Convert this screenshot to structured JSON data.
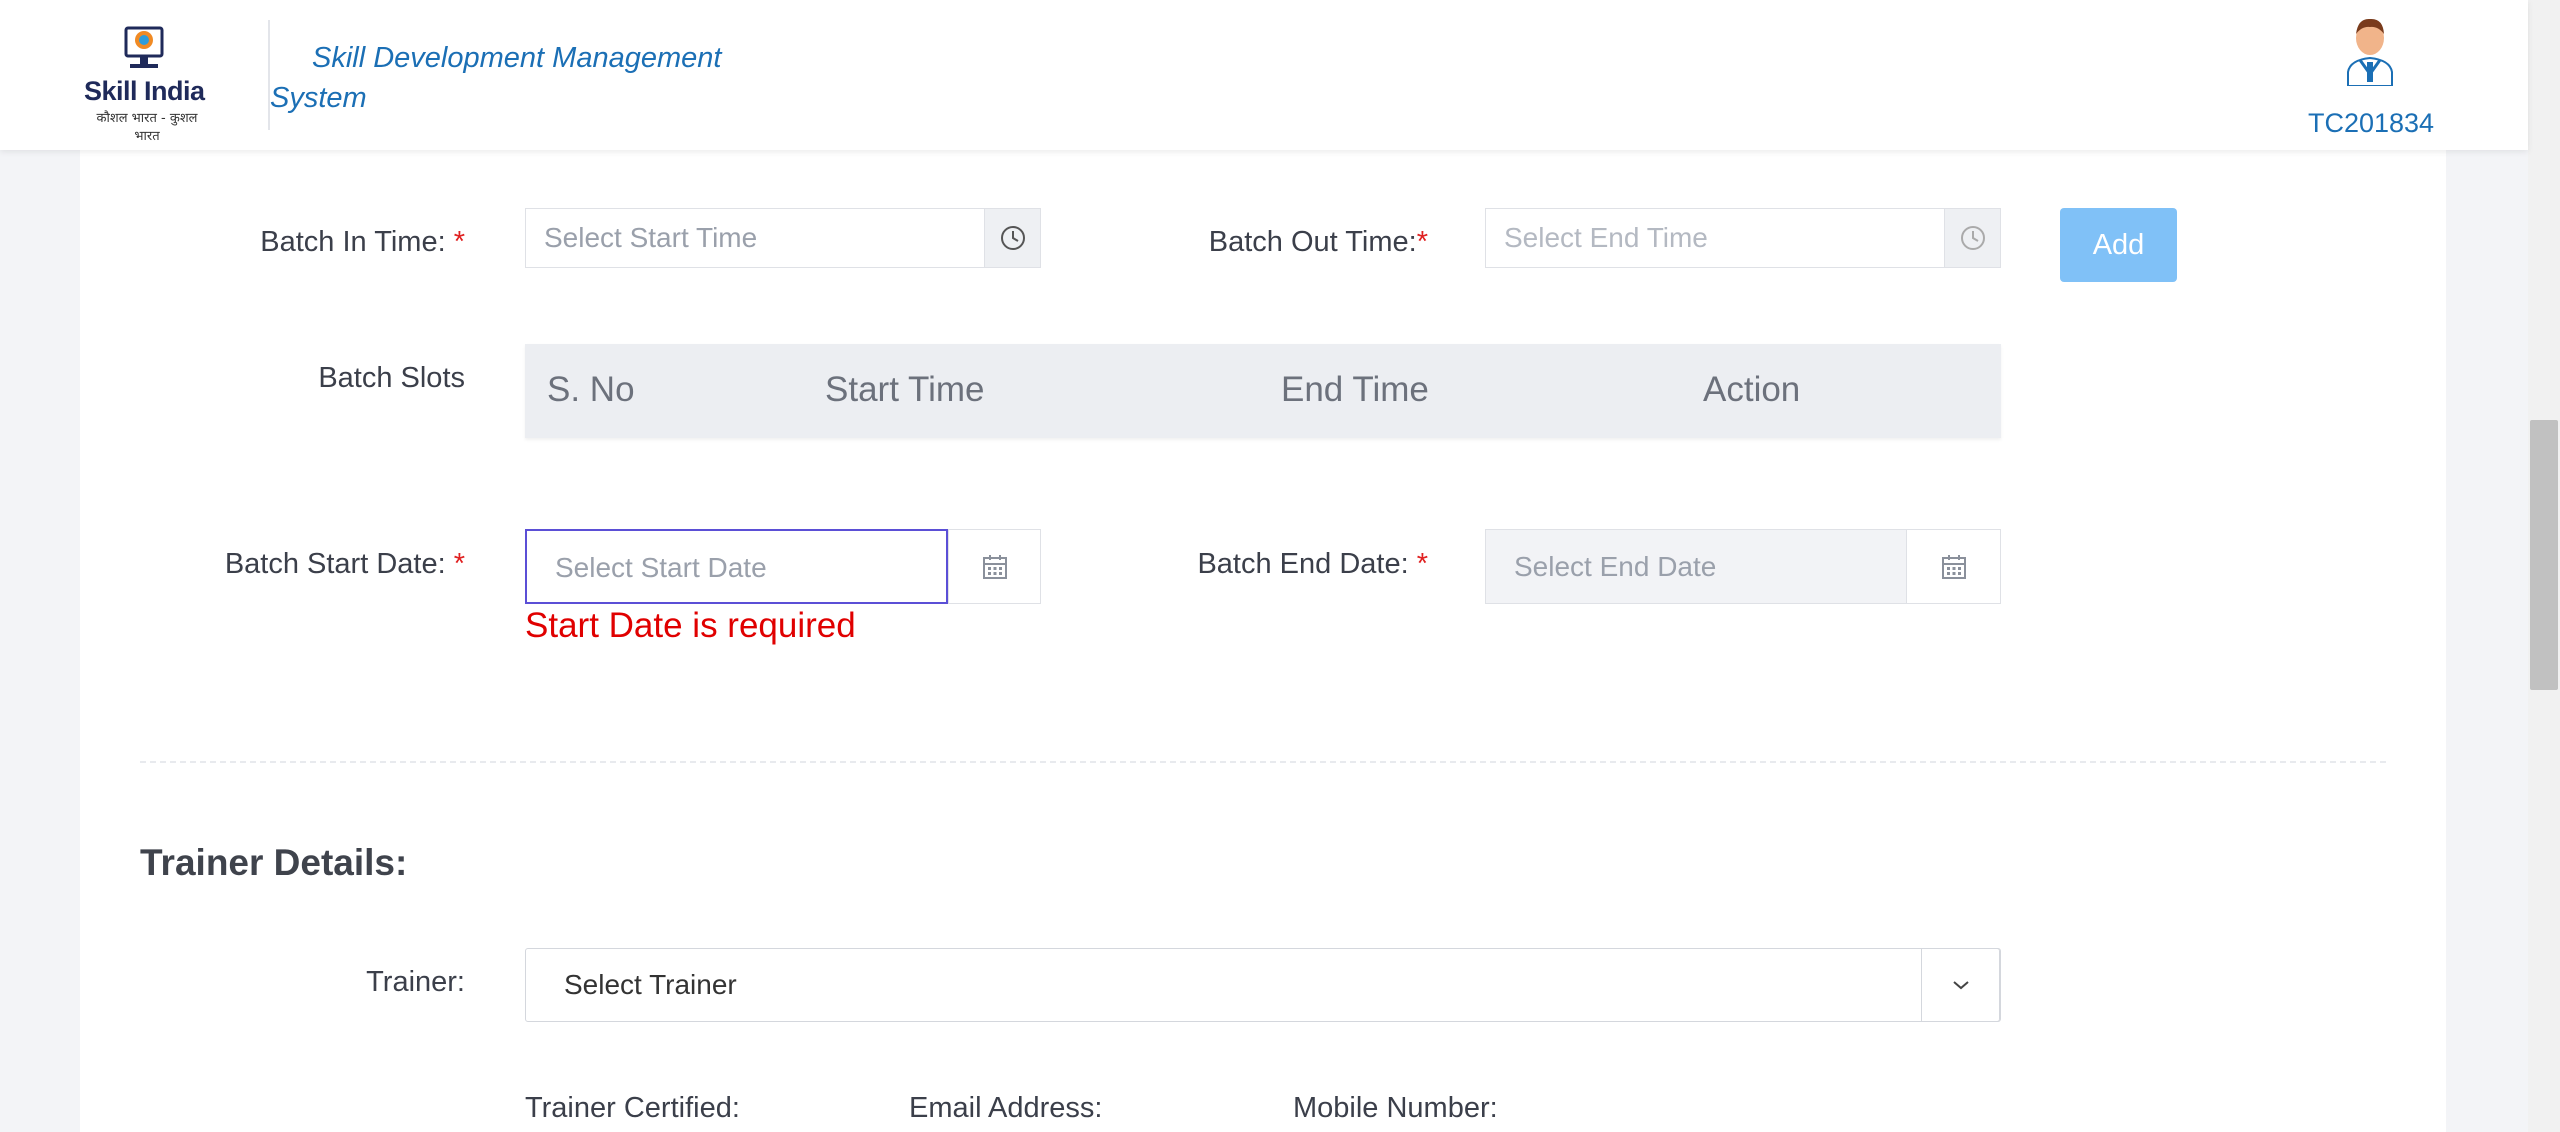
{
  "header": {
    "logo_text": "Skill India",
    "logo_tagline": "कौशल भारत - कुशल भारत",
    "system_title_line1": "Skill Development Management",
    "system_title_line2": "System",
    "user_id": "TC201834"
  },
  "form": {
    "batch_in_time": {
      "label": "Batch In Time: ",
      "required": "*",
      "placeholder": "Select Start Time"
    },
    "batch_out_time": {
      "label": "Batch Out Time:",
      "required": "*",
      "placeholder": "Select End Time"
    },
    "add_button": "Add",
    "batch_slots": {
      "label": "Batch Slots",
      "columns": [
        "S. No",
        "Start Time",
        "End Time",
        "Action"
      ]
    },
    "batch_start_date": {
      "label": "Batch Start Date: ",
      "required": "*",
      "placeholder": "Select Start Date",
      "error": "Start Date is required"
    },
    "batch_end_date": {
      "label": "Batch End Date: ",
      "required": "*",
      "placeholder": "Select End Date"
    }
  },
  "trainer": {
    "section_title": "Trainer Details:",
    "label": "Trainer:",
    "selected": "Select Trainer",
    "info_labels": [
      "Trainer Certified:",
      "Email Address:",
      "Mobile Number:"
    ]
  },
  "colors": {
    "accent": "#1b6fb5",
    "add_button": "#80c1f7",
    "error": "#e00000",
    "focus_border": "#5b4fd6"
  },
  "icons": [
    "clock-icon",
    "calendar-icon",
    "chevron-down-icon",
    "user-avatar",
    "skill-india-logo"
  ]
}
